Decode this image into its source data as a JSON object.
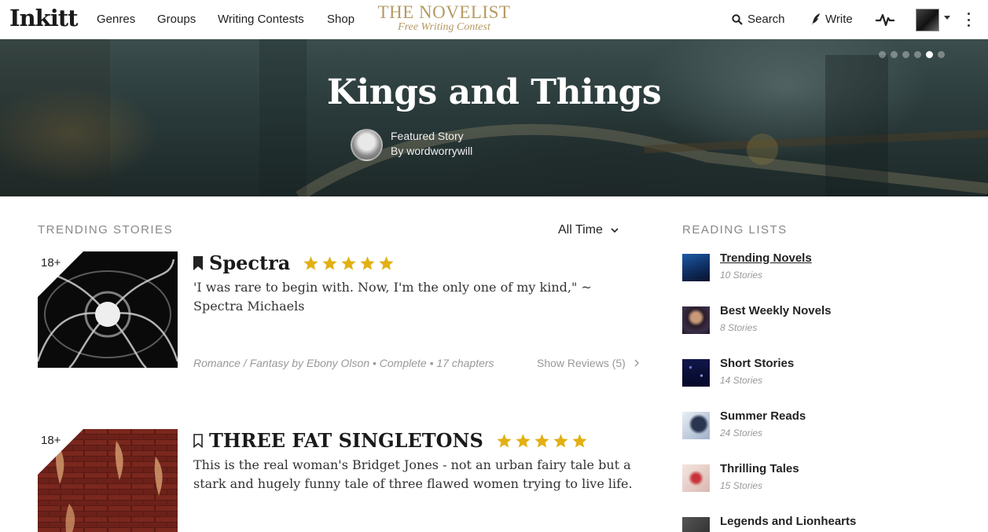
{
  "nav": {
    "logo": "Inkitt",
    "links": [
      "Genres",
      "Groups",
      "Writing Contests",
      "Shop"
    ],
    "promo_line1": "THE NOVELIST",
    "promo_line2": "Free Writing Contest",
    "search_label": "Search",
    "write_label": "Write"
  },
  "hero": {
    "title": "Kings and Things",
    "featured_label": "Featured Story",
    "author_label": "By wordworrywill",
    "slide_count": 6,
    "active_slide": 5
  },
  "trending": {
    "section_title": "TRENDING STORIES",
    "filter_label": "All Time",
    "stories": [
      {
        "age": "18+",
        "title": "Spectra",
        "bookmarked": true,
        "rating": 5,
        "description": "'I was rare to begin with. Now, I'm the only one of my kind,\" ~ Spectra Michaels",
        "meta": "Romance / Fantasy by Ebony Olson • Complete • 17 chapters",
        "reviews": "Show Reviews (5)"
      },
      {
        "age": "18+",
        "title": "THREE FAT SINGLETONS",
        "bookmarked": false,
        "rating": 5,
        "description": "This is the real woman's Bridget Jones - not an urban fairy tale but a stark and hugely funny tale of three flawed women trying to live life."
      }
    ]
  },
  "reading_lists": {
    "section_title": "READING LISTS",
    "items": [
      {
        "name": "Trending Novels",
        "count": "10 Stories"
      },
      {
        "name": "Best Weekly Novels",
        "count": "8 Stories"
      },
      {
        "name": "Short Stories",
        "count": "14 Stories"
      },
      {
        "name": "Summer Reads",
        "count": "24 Stories"
      },
      {
        "name": "Thrilling Tales",
        "count": "15 Stories"
      },
      {
        "name": "Legends and Lionhearts",
        "count": ""
      }
    ]
  },
  "colors": {
    "star": "#e2b013",
    "muted": "#999999"
  }
}
